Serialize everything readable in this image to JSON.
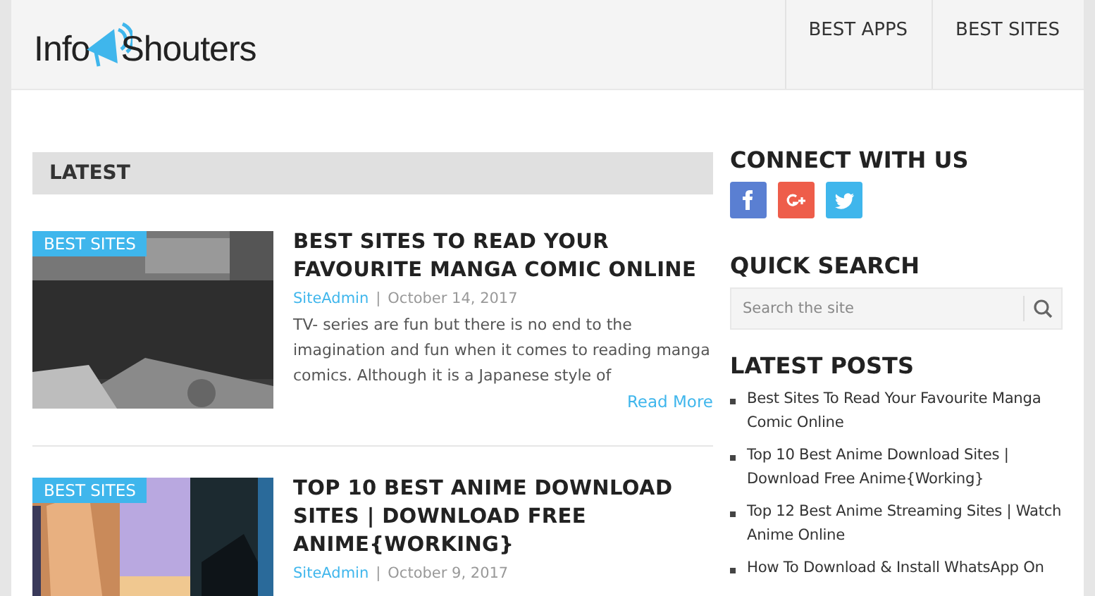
{
  "header": {
    "logo": [
      "Info",
      "Shouters"
    ],
    "nav": [
      {
        "label": "BEST APPS"
      },
      {
        "label": "BEST SITES"
      }
    ]
  },
  "main": {
    "section_title": "LATEST",
    "posts": [
      {
        "category": "BEST SITES",
        "title": "BEST SITES TO READ YOUR FAVOURITE MANGA COMIC ONLINE",
        "author": "SiteAdmin",
        "separator": "|",
        "date": "October 14, 2017",
        "excerpt": "TV- series are fun but there is no end to the imagination and fun when it comes to reading manga comics. Although it is a Japanese style of",
        "read_more": "Read More"
      },
      {
        "category": "BEST SITES",
        "title": "TOP 10 BEST ANIME DOWNLOAD SITES | DOWNLOAD FREE ANIME{WORKING}",
        "author": "SiteAdmin",
        "separator": "|",
        "date": "October 9, 2017"
      }
    ]
  },
  "sidebar": {
    "connect": {
      "title": "CONNECT WITH US",
      "social": [
        {
          "kind": "facebook",
          "color": "#5a7fd2"
        },
        {
          "kind": "googleplus",
          "color": "#ee5d4a"
        },
        {
          "kind": "twitter",
          "color": "#3fb6ec"
        }
      ]
    },
    "search": {
      "title": "QUICK SEARCH",
      "placeholder": "Search the site"
    },
    "latest_posts": {
      "title": "LATEST POSTS",
      "items": [
        "Best Sites To Read Your Favourite Manga Comic Online",
        "Top 10 Best Anime Download Sites | Download Free Anime{Working}",
        "Top 12 Best Anime Streaming Sites | Watch Anime Online",
        "How To Download & Install WhatsApp On"
      ]
    }
  }
}
